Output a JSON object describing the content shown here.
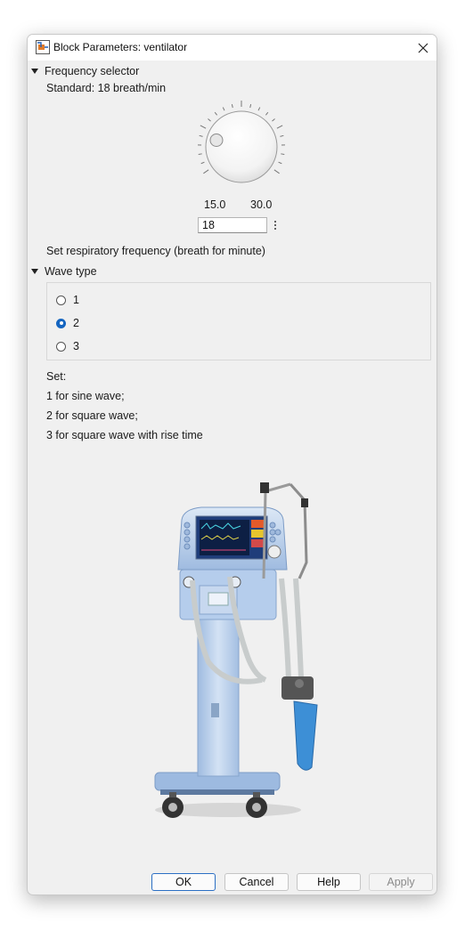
{
  "window": {
    "title": "Block Parameters: ventilator",
    "app_icon": "simulink-block-icon",
    "close_icon": "close-icon"
  },
  "frequency": {
    "section_label": "Frequency selector",
    "standard_text": "Standard: 18 breath/min",
    "min_label": "15.0",
    "max_label": "30.0",
    "min_value": 15,
    "max_value": 30,
    "value": "18",
    "description": "Set respiratory frequency (breath for minute)"
  },
  "wave": {
    "section_label": "Wave type",
    "options": [
      "1",
      "2",
      "3"
    ],
    "selected": "2",
    "help_lines": [
      "Set:",
      "1 for sine wave;",
      "2 for square wave;",
      "3 for square wave with rise time"
    ]
  },
  "image": {
    "subject": "medical-ventilator-illustration"
  },
  "buttons": {
    "ok": "OK",
    "cancel": "Cancel",
    "help": "Help",
    "apply": "Apply"
  },
  "colors": {
    "accent": "#1565c0",
    "dialog_bg": "#f0f0f0",
    "ventilator_blue": "#a9c4e6"
  }
}
